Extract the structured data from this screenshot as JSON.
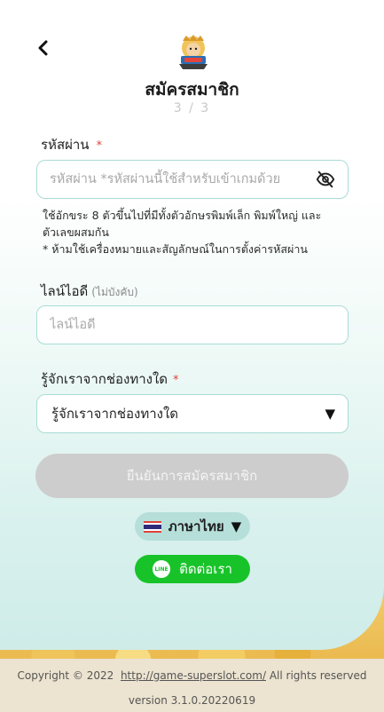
{
  "header": {
    "title": "สมัครสมาชิก",
    "step": "3 / 3"
  },
  "password": {
    "label": "รหัสผ่าน",
    "required_mark": "*",
    "placeholder": "รหัสผ่าน *รหัสผ่านนี้ใช้สำหรับเข้าเกมด้วย",
    "value": "",
    "toggle_icon": "eye-slash-icon"
  },
  "password_hints": [
    "ใช้อักขระ 8 ตัวขึ้นไปที่มีทั้งตัวอักษรพิมพ์เล็ก พิมพ์ใหญ่ และตัวเลขผสมกัน",
    "* ห้ามใช้เครื่องหมายและสัญลักษณ์ในการตั้งค่ารหัสผ่าน"
  ],
  "line_id": {
    "label": "ไลน์ไอดี",
    "optional_note": "(ไม่บังคับ)",
    "placeholder": "ไลน์ไอดี",
    "value": ""
  },
  "source": {
    "label": "รู้จักเราจากช่องทางใด",
    "required_mark": "*",
    "selected": "รู้จักเราจากช่องทางใด"
  },
  "submit_label": "ยืนยันการสมัครสมาชิก",
  "language": {
    "label": "ภาษาไทย",
    "flag": "thai-flag-icon"
  },
  "contact_label": "ติดต่อเรา",
  "line_icon_text": "LINE",
  "footer": {
    "copyright_prefix": "Copyright © 2022",
    "link": "http://game-superslot.com/",
    "copyright_suffix": "All rights reserved",
    "version": "version 3.1.0.20220619"
  },
  "colors": {
    "accent_border": "#a9dcd6",
    "required": "#e0413a",
    "line_green": "#18c329",
    "submit_disabled": "#cdcdcd",
    "lang_pill": "#b6dfd9"
  }
}
